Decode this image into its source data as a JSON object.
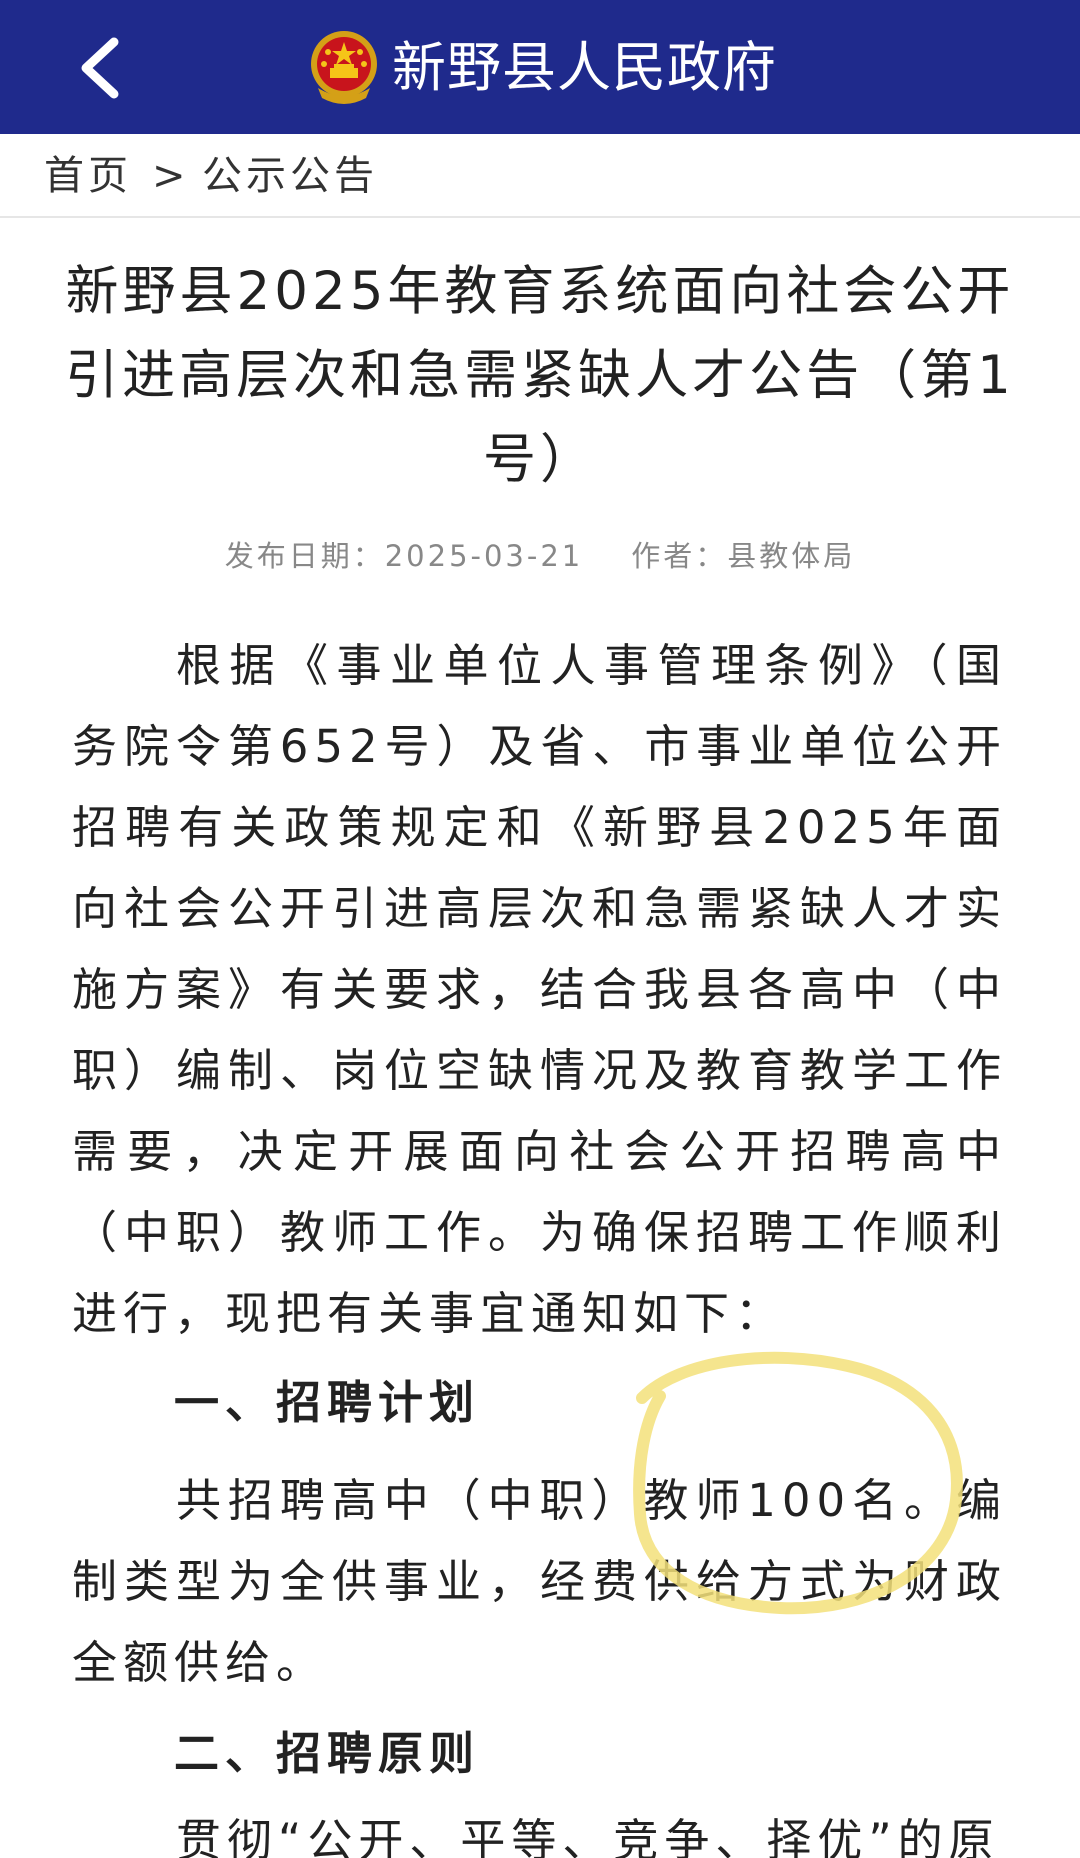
{
  "header": {
    "site_title": "新野县人民政府",
    "bg_color": "#1f2a8c",
    "back_icon": "chevron-left-icon",
    "emblem_icon": "national-emblem-icon"
  },
  "breadcrumb": {
    "home": "首页",
    "separator": ">",
    "current": "公示公告"
  },
  "article": {
    "title": "新野县2025年教育系统面向社会公开引进高层次和急需紧缺人才公告（第1号）",
    "publish_label": "发布日期：",
    "publish_date": "2025-03-21",
    "author_label": "作者：",
    "author": "县教体局",
    "intro": "根据《事业单位人事管理条例》（国务院令第652号）及省、市事业单位公开招聘有关政策规定和《新野县2025年面向社会公开引进高层次和急需紧缺人才实施方案》有关要求，结合我县各高中（中职）编制、岗位空缺情况及教育教学工作需要，决定开展面向社会公开招聘高中（中职）教师工作。为确保招聘工作顺利进行，现把有关事宜通知如下：",
    "section1_heading": "一、招聘计划",
    "section1_text": "共招聘高中（中职）教师100名。编制类型为全供事业，经费供给方式为财政全额供给。",
    "section2_heading": "二、招聘原则",
    "section2_text": "贯彻“公开、平等、竞争、择优”的原"
  },
  "annotation": {
    "highlight_color": "#f3e07a"
  }
}
